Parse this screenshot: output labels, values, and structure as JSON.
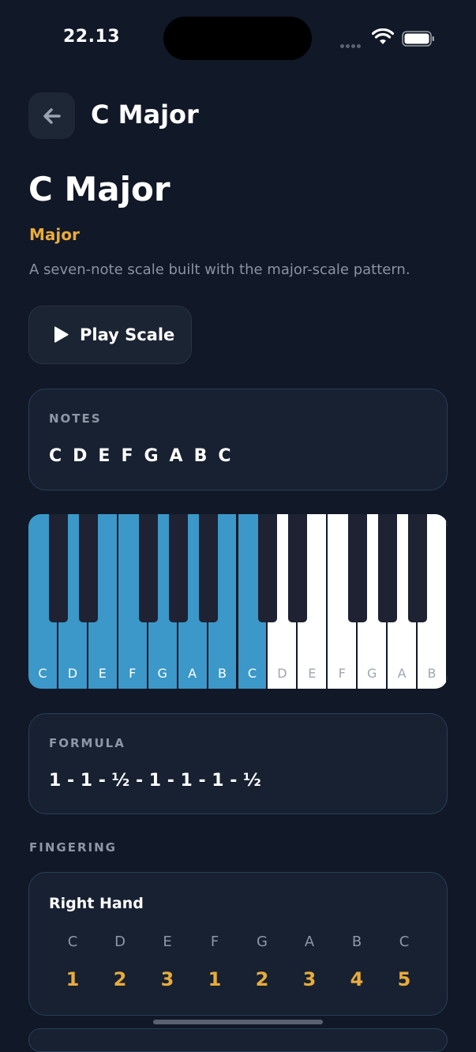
{
  "status_bar": {
    "time": "22.13"
  },
  "header": {
    "nav_title": "C Major"
  },
  "scale": {
    "title": "C Major",
    "type": "Major",
    "description": "A seven-note scale built with the major-scale pattern."
  },
  "play_button": {
    "label": "Play Scale"
  },
  "notes": {
    "label": "NOTES",
    "values": [
      "C",
      "D",
      "E",
      "F",
      "G",
      "A",
      "B",
      "C"
    ]
  },
  "piano": {
    "white_keys": [
      {
        "note": "C",
        "highlighted": true
      },
      {
        "note": "D",
        "highlighted": true
      },
      {
        "note": "E",
        "highlighted": true
      },
      {
        "note": "F",
        "highlighted": true
      },
      {
        "note": "G",
        "highlighted": true
      },
      {
        "note": "A",
        "highlighted": true
      },
      {
        "note": "B",
        "highlighted": true
      },
      {
        "note": "C",
        "highlighted": true
      },
      {
        "note": "D",
        "highlighted": false
      },
      {
        "note": "E",
        "highlighted": false
      },
      {
        "note": "F",
        "highlighted": false
      },
      {
        "note": "G",
        "highlighted": false
      },
      {
        "note": "A",
        "highlighted": false
      },
      {
        "note": "B",
        "highlighted": false
      }
    ],
    "colors": {
      "highlight": "#3b98c8",
      "white": "#ffffff",
      "black": "#1e2232"
    }
  },
  "formula": {
    "label": "FORMULA",
    "value": "1 - 1 - ½ - 1 - 1 - 1 - ½"
  },
  "fingering": {
    "label": "FINGERING",
    "right_hand": {
      "title": "Right Hand",
      "notes": [
        "C",
        "D",
        "E",
        "F",
        "G",
        "A",
        "B",
        "C"
      ],
      "fingers": [
        "1",
        "2",
        "3",
        "1",
        "2",
        "3",
        "4",
        "5"
      ]
    }
  },
  "colors": {
    "accent": "#e9ac3a",
    "background": "#111827",
    "card": "#172131"
  }
}
